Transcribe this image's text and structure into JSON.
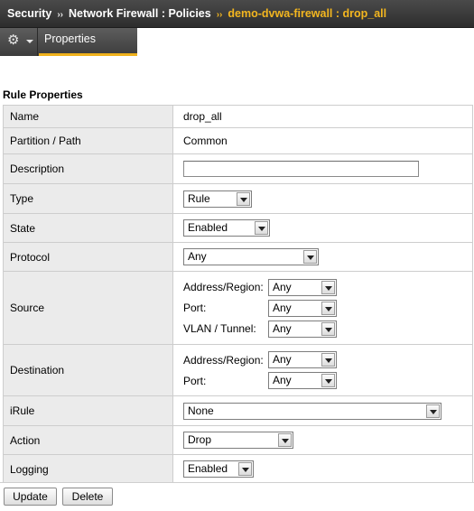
{
  "breadcrumb": {
    "root": "Security",
    "section": "Network Firewall : Policies",
    "current": "demo-dvwa-firewall : drop_all",
    "separator": "››"
  },
  "toolbar": {
    "settings_icon": "gear-icon",
    "tab_label": "Properties"
  },
  "rule_properties": {
    "heading": "Rule Properties",
    "name_label": "Name",
    "name_value": "drop_all",
    "partition_label": "Partition / Path",
    "partition_value": "Common",
    "description_label": "Description",
    "description_value": "",
    "type_label": "Type",
    "type_value": "Rule",
    "state_label": "State",
    "state_value": "Enabled",
    "protocol_label": "Protocol",
    "protocol_value": "Any",
    "source": {
      "label": "Source",
      "address_label": "Address/Region:",
      "address_value": "Any",
      "port_label": "Port:",
      "port_value": "Any",
      "vlan_label": "VLAN / Tunnel:",
      "vlan_value": "Any"
    },
    "destination": {
      "label": "Destination",
      "address_label": "Address/Region:",
      "address_value": "Any",
      "port_label": "Port:",
      "port_value": "Any"
    },
    "irule_label": "iRule",
    "irule_value": "None",
    "action_label": "Action",
    "action_value": "Drop",
    "logging_label": "Logging",
    "logging_value": "Enabled"
  },
  "buttons": {
    "update": "Update",
    "delete": "Delete"
  },
  "colors": {
    "accent": "#f0b21c",
    "titlebar": "#3a3a3a",
    "label_bg": "#ebebeb"
  }
}
